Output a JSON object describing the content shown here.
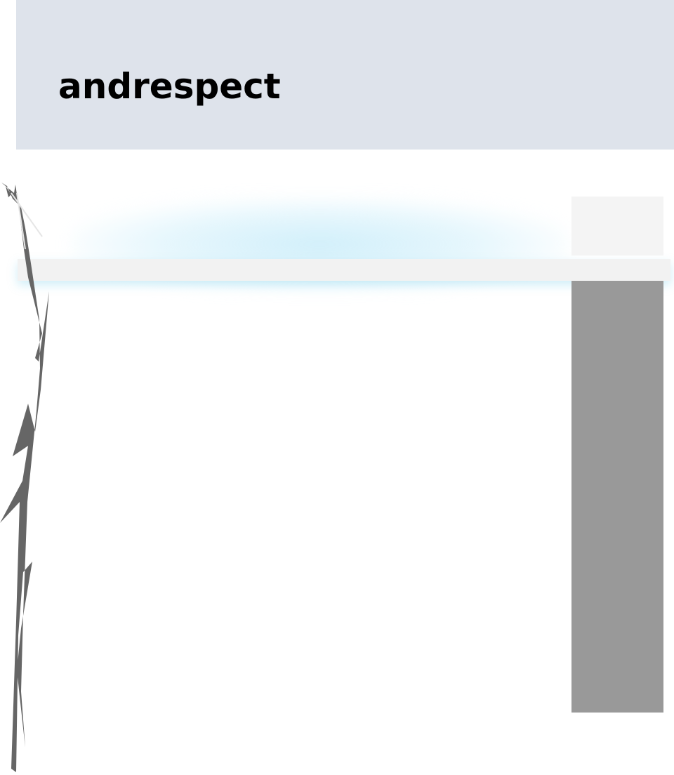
{
  "header": {
    "title": "andrespect"
  },
  "colors": {
    "header_background": "#dee3eb",
    "nav_bar": "#f2f2f2",
    "sidebar_panel": "#999999",
    "sidebar_top": "#f4f4f4",
    "decoration": "#666666"
  },
  "icons": {
    "left_decoration": "vine-decoration"
  }
}
